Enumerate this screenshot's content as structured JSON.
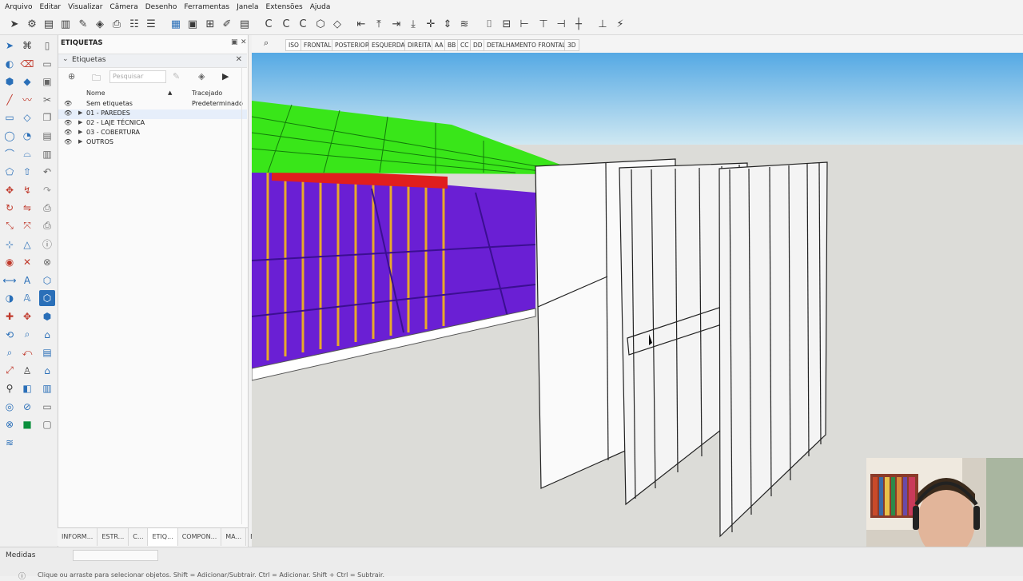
{
  "menu": [
    "Arquivo",
    "Editar",
    "Visualizar",
    "Câmera",
    "Desenho",
    "Ferramentas",
    "Janela",
    "Extensões",
    "Ajuda"
  ],
  "tray": {
    "title": "ETIQUETAS",
    "section": "Etiquetas",
    "search_placeholder": "Pesquisar",
    "col_name": "Nome",
    "col_dash": "Tracejado",
    "untagged": "Sem etiquetas",
    "untagged_dash": "Predeterminado",
    "tags": [
      "01 - PAREDES",
      "02 - LAJE TÉCNICA",
      "03 - COBERTURA",
      "OUTROS"
    ],
    "bottom_tabs": [
      "INFORM...",
      "ESTR...",
      "C...",
      "ETIQ...",
      "COMPON...",
      "MA...",
      "E..."
    ]
  },
  "scenes": [
    "ISO",
    "FRONTAL",
    "POSTERIOR",
    "ESQUERDA",
    "DIREITA",
    "AA",
    "BB",
    "CC",
    "DD",
    "DETALHAMENTO FRONTAL",
    "3D"
  ],
  "status": {
    "measurements_label": "Medidas",
    "hint": "Clique ou arraste para selecionar objetos. Shift = Adicionar/Subtrair. Ctrl = Adicionar. Shift + Ctrl = Subtrair."
  },
  "colors": {
    "roof_green": "#39e619",
    "wall_purple": "#6a1fd4",
    "stud_orange": "#e8a92a",
    "beam_red": "#e01e1e",
    "sky_top": "#55a9e4",
    "ground": "#dcdcd8"
  }
}
